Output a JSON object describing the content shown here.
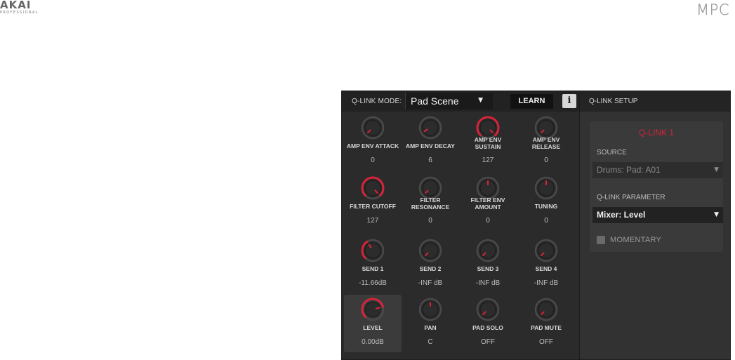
{
  "brand": {
    "left_logo": "AKAI",
    "left_sub": "PROFESSIONAL",
    "right_logo": "MPC"
  },
  "toolbar": {
    "mode_label": "Q-LINK MODE:",
    "mode_value": "Pad Scene",
    "learn_label": "LEARN",
    "info_label": "i"
  },
  "knobs": [
    {
      "line1": "AMP ENV ATTACK",
      "line2": "",
      "value": "0",
      "level": 0.0,
      "active": false
    },
    {
      "line1": "AMP ENV DECAY",
      "line2": "",
      "value": "6",
      "level": 0.05,
      "active": false
    },
    {
      "line1": "AMP ENV",
      "line2": "SUSTAIN",
      "value": "127",
      "level": 1.0,
      "active": true
    },
    {
      "line1": "AMP ENV",
      "line2": "RELEASE",
      "value": "0",
      "level": 0.0,
      "active": false
    },
    {
      "line1": "FILTER CUTOFF",
      "line2": "",
      "value": "127",
      "level": 1.0,
      "active": true
    },
    {
      "line1": "FILTER",
      "line2": "RESONANCE",
      "value": "0",
      "level": 0.0,
      "active": false
    },
    {
      "line1": "FILTER ENV",
      "line2": "AMOUNT",
      "value": "0",
      "level": 0.5,
      "active": false
    },
    {
      "line1": "TUNING",
      "line2": "",
      "value": "0",
      "level": 0.5,
      "active": false
    },
    {
      "line1": "SEND 1",
      "line2": "",
      "value": "-11.66dB",
      "level": 0.38,
      "active": true
    },
    {
      "line1": "SEND 2",
      "line2": "",
      "value": "-INF dB",
      "level": 0.0,
      "active": false
    },
    {
      "line1": "SEND 3",
      "line2": "",
      "value": "-INF dB",
      "level": 0.0,
      "active": false
    },
    {
      "line1": "SEND 4",
      "line2": "",
      "value": "-INF dB",
      "level": 0.0,
      "active": false
    },
    {
      "line1": "LEVEL",
      "line2": "",
      "value": "0.00dB",
      "level": 0.78,
      "active": true,
      "selected": true
    },
    {
      "line1": "PAN",
      "line2": "",
      "value": "C",
      "level": 0.5,
      "active": false
    },
    {
      "line1": "PAD SOLO",
      "line2": "",
      "value": "OFF",
      "level": 0.0,
      "active": false
    },
    {
      "line1": "PAD MUTE",
      "line2": "",
      "value": "OFF",
      "level": 0.0,
      "active": false
    }
  ],
  "setup": {
    "title": "Q-LINK SETUP",
    "qlink_title": "Q-LINK 1",
    "source_label": "SOURCE",
    "source_value": "Drums: Pad: A01",
    "param_label": "Q-LINK PARAMETER",
    "param_value": "Mixer: Level",
    "momentary_label": "MOMENTARY",
    "momentary_checked": false
  },
  "colors": {
    "accent": "#d6243b",
    "knob_body": "#2c2c2c",
    "ring_off": "#4a4a4a"
  }
}
